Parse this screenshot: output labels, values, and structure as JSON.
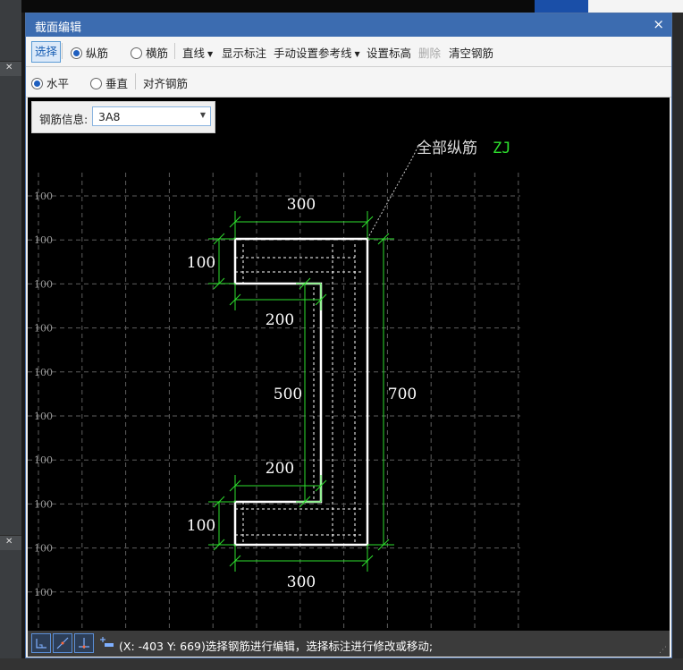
{
  "dialog": {
    "title": "截面编辑",
    "close_glyph": "×"
  },
  "toolbar1": {
    "select_label": "选择",
    "longitudinal_label": "纵筋",
    "transverse_label": "横筋",
    "line_label": "直线",
    "show_annotation_label": "显示标注",
    "manual_ref_line_label": "手动设置参考线",
    "set_elevation_label": "设置标高",
    "delete_label": "删除",
    "clear_rebar_label": "清空钢筋",
    "selected_mode": "纵筋"
  },
  "toolbar2": {
    "horizontal_label": "水平",
    "vertical_label": "垂直",
    "align_rebar_label": "对齐钢筋",
    "selected_orientation": "水平"
  },
  "rebar_info": {
    "label": "钢筋信息:",
    "value": "3A8"
  },
  "drawing": {
    "grid_labels": [
      "100",
      "100",
      "100",
      "100",
      "100",
      "100",
      "100",
      "100",
      "100",
      "100"
    ],
    "leader_text": "全部纵筋",
    "leader_code": "ZJ",
    "dims": {
      "top_width": "300",
      "top_flange": "100",
      "top_lip": "200",
      "web_inner": "500",
      "total_height": "700",
      "bottom_lip": "200",
      "bottom_flange": "100",
      "bottom_width": "300"
    },
    "colors": {
      "dim": "#2ee02e",
      "outline": "#ffffff",
      "grid": "#6a6a6a",
      "code": "#2ee02e"
    }
  },
  "statusbar": {
    "icons": [
      "ortho-icon",
      "polar-icon",
      "snap-icon",
      "add-ref-icon"
    ],
    "text": "(X: -403 Y: 669)选择钢筋进行编辑，选择标注进行修改或移动;"
  }
}
